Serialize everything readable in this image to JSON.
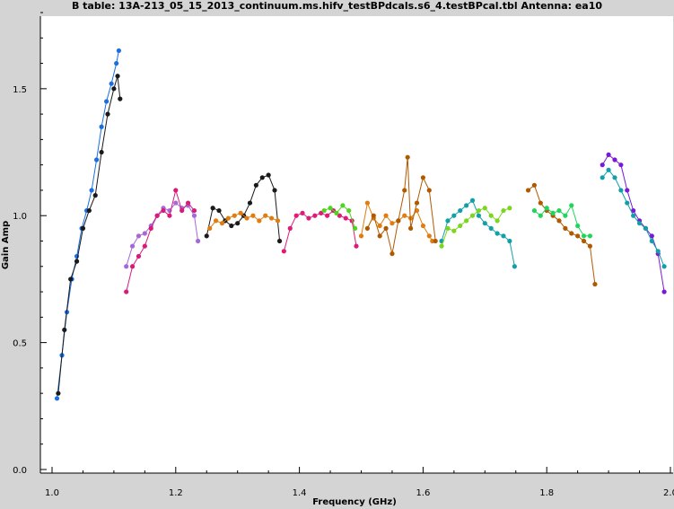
{
  "chart_data": {
    "type": "scatter",
    "title": "B table: 13A-213_05_15_2013_continuum.ms.hifv_testBPdcals.s6_4.testBPcal.tbl   Antenna: ea10",
    "xlabel": "Frequency (GHz)",
    "ylabel": "Gain Amp",
    "xlim": [
      1.0,
      2.0
    ],
    "ylim": [
      0.0,
      1.8
    ],
    "x_ticks": [
      "1.0",
      "1.2",
      "1.4",
      "1.6",
      "1.8",
      "2.0"
    ],
    "y_ticks": [
      "0.0",
      "0.5",
      "1.0",
      "1.5"
    ],
    "grid": false,
    "series": [
      {
        "color": "#1a6fe0",
        "x": [
          1.008,
          1.016,
          1.024,
          1.032,
          1.04,
          1.048,
          1.056,
          1.064,
          1.072,
          1.08,
          1.088,
          1.096,
          1.104,
          1.108
        ],
        "y": [
          0.28,
          0.45,
          0.62,
          0.75,
          0.84,
          0.95,
          1.02,
          1.1,
          1.22,
          1.35,
          1.45,
          1.52,
          1.6,
          1.65
        ]
      },
      {
        "color": "#1a1a1a",
        "x": [
          1.01,
          1.02,
          1.03,
          1.04,
          1.05,
          1.06,
          1.07,
          1.08,
          1.09,
          1.1,
          1.106,
          1.11
        ],
        "y": [
          0.3,
          0.55,
          0.75,
          0.82,
          0.95,
          1.02,
          1.08,
          1.25,
          1.4,
          1.5,
          1.55,
          1.46
        ]
      },
      {
        "color": "#a668d8",
        "x": [
          1.12,
          1.13,
          1.14,
          1.15,
          1.16,
          1.17,
          1.18,
          1.19,
          1.2,
          1.21,
          1.22,
          1.23,
          1.236
        ],
        "y": [
          0.8,
          0.88,
          0.92,
          0.93,
          0.96,
          1.0,
          1.03,
          1.02,
          1.05,
          1.03,
          1.04,
          1.0,
          0.9
        ]
      },
      {
        "color": "#d81a78",
        "x": [
          1.12,
          1.13,
          1.14,
          1.15,
          1.16,
          1.17,
          1.18,
          1.19,
          1.2,
          1.21,
          1.22,
          1.23
        ],
        "y": [
          0.7,
          0.8,
          0.84,
          0.88,
          0.95,
          1.0,
          1.02,
          1.0,
          1.1,
          1.02,
          1.05,
          1.02
        ]
      },
      {
        "color": "#1a1a1a",
        "x": [
          1.25,
          1.26,
          1.27,
          1.28,
          1.29,
          1.3,
          1.31,
          1.32,
          1.33,
          1.34,
          1.35,
          1.36,
          1.368
        ],
        "y": [
          0.92,
          1.03,
          1.02,
          0.98,
          0.96,
          0.97,
          1.0,
          1.05,
          1.12,
          1.15,
          1.16,
          1.1,
          0.9
        ]
      },
      {
        "color": "#e07c10",
        "x": [
          1.255,
          1.265,
          1.275,
          1.285,
          1.295,
          1.305,
          1.315,
          1.325,
          1.335,
          1.345,
          1.355,
          1.365
        ],
        "y": [
          0.95,
          0.98,
          0.97,
          0.99,
          1.0,
          1.01,
          0.99,
          1.0,
          0.98,
          1.0,
          0.99,
          0.98
        ]
      },
      {
        "color": "#e01a78",
        "x": [
          1.375,
          1.385,
          1.395,
          1.405,
          1.415,
          1.425,
          1.435,
          1.445,
          1.455,
          1.465,
          1.475,
          1.485,
          1.492
        ],
        "y": [
          0.86,
          0.95,
          1.0,
          1.01,
          0.99,
          1.0,
          1.01,
          1.0,
          1.02,
          1.0,
          0.99,
          0.98,
          0.88
        ]
      },
      {
        "color": "#4cd620",
        "x": [
          1.44,
          1.45,
          1.46,
          1.47,
          1.48,
          1.49
        ],
        "y": [
          1.02,
          1.03,
          1.01,
          1.04,
          1.02,
          0.95
        ]
      },
      {
        "color": "#e07c10",
        "x": [
          1.5,
          1.51,
          1.52,
          1.53,
          1.54,
          1.55,
          1.56,
          1.57,
          1.58,
          1.59,
          1.6,
          1.61,
          1.615
        ],
        "y": [
          0.92,
          1.05,
          0.99,
          0.96,
          1.0,
          0.97,
          0.98,
          1.0,
          0.99,
          1.02,
          0.96,
          0.92,
          0.9
        ]
      },
      {
        "color": "#b05a00",
        "x": [
          1.51,
          1.52,
          1.53,
          1.54,
          1.55,
          1.56,
          1.57,
          1.575,
          1.58,
          1.59,
          1.6,
          1.61,
          1.62
        ],
        "y": [
          0.95,
          1.0,
          0.92,
          0.95,
          0.85,
          0.98,
          1.1,
          1.23,
          0.95,
          1.05,
          1.15,
          1.1,
          0.9
        ]
      },
      {
        "color": "#12a0a8",
        "x": [
          1.63,
          1.64,
          1.65,
          1.66,
          1.67,
          1.68,
          1.69,
          1.7,
          1.71,
          1.72,
          1.73,
          1.74,
          1.748
        ],
        "y": [
          0.9,
          0.98,
          1.0,
          1.02,
          1.04,
          1.06,
          1.0,
          0.97,
          0.95,
          0.93,
          0.92,
          0.9,
          0.8
        ]
      },
      {
        "color": "#7cd620",
        "x": [
          1.63,
          1.64,
          1.65,
          1.66,
          1.67,
          1.68,
          1.69,
          1.7,
          1.71,
          1.72,
          1.73,
          1.74
        ],
        "y": [
          0.88,
          0.95,
          0.94,
          0.96,
          0.98,
          1.0,
          1.02,
          1.03,
          1.0,
          0.98,
          1.02,
          1.03
        ]
      },
      {
        "color": "#b05a00",
        "x": [
          1.77,
          1.78,
          1.79,
          1.8,
          1.81,
          1.82,
          1.83,
          1.84,
          1.85,
          1.86,
          1.87,
          1.878
        ],
        "y": [
          1.1,
          1.12,
          1.05,
          1.02,
          1.0,
          0.98,
          0.95,
          0.93,
          0.92,
          0.9,
          0.88,
          0.73
        ]
      },
      {
        "color": "#20d65a",
        "x": [
          1.78,
          1.79,
          1.8,
          1.81,
          1.82,
          1.83,
          1.84,
          1.85,
          1.86,
          1.87
        ],
        "y": [
          1.02,
          1.0,
          1.03,
          1.01,
          1.02,
          1.0,
          1.04,
          0.96,
          0.92,
          0.92
        ]
      },
      {
        "color": "#7a18d8",
        "x": [
          1.89,
          1.9,
          1.91,
          1.92,
          1.93,
          1.94,
          1.95,
          1.96,
          1.97,
          1.98,
          1.99
        ],
        "y": [
          1.2,
          1.24,
          1.22,
          1.2,
          1.1,
          1.02,
          0.98,
          0.95,
          0.92,
          0.85,
          0.7
        ]
      },
      {
        "color": "#12a0a8",
        "x": [
          1.89,
          1.9,
          1.91,
          1.92,
          1.93,
          1.94,
          1.95,
          1.96,
          1.97,
          1.98,
          1.99
        ],
        "y": [
          1.15,
          1.18,
          1.15,
          1.1,
          1.05,
          1.0,
          0.97,
          0.95,
          0.9,
          0.86,
          0.8
        ]
      }
    ]
  }
}
